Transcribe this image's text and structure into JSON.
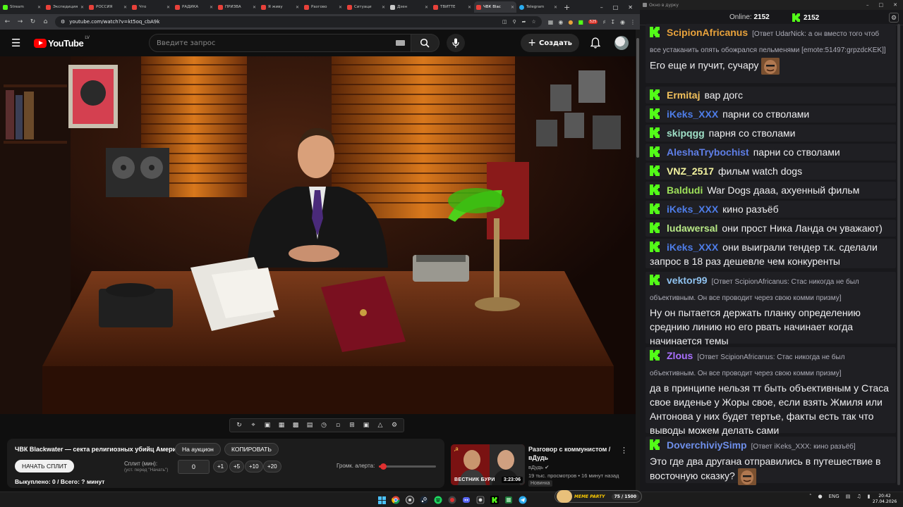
{
  "browser": {
    "tabs": [
      {
        "label": "Stream",
        "fav": "k",
        "active": false
      },
      {
        "label": "Экспедиция",
        "fav": "yt",
        "active": false
      },
      {
        "label": "РОССИЯ",
        "fav": "yt",
        "active": false
      },
      {
        "label": "Что",
        "fav": "yt",
        "active": false
      },
      {
        "label": "РАДИКА",
        "fav": "yt",
        "active": false
      },
      {
        "label": "ПРИЗВА",
        "fav": "yt",
        "active": false
      },
      {
        "label": "Я живу",
        "fav": "yt",
        "active": false
      },
      {
        "label": "Разгово",
        "fav": "yt",
        "active": false
      },
      {
        "label": "Ситуаци",
        "fav": "yt",
        "active": false
      },
      {
        "label": "Дзен",
        "fav": "dz",
        "active": false
      },
      {
        "label": "ТВИТТЕ",
        "fav": "yt",
        "active": false
      },
      {
        "label": "ЧВК Blac",
        "fav": "yt",
        "active": true
      },
      {
        "label": "Telegram",
        "fav": "tg",
        "active": false
      }
    ],
    "new_tab": "+",
    "url": "youtube.com/watch?v=kt5oq_cbA9k",
    "ext_badge": "525",
    "icons": [
      "back-icon",
      "forward-icon",
      "reload-icon",
      "home-icon",
      "site-info-icon",
      "star-icon",
      "extensions-icon",
      "download-icon",
      "menu-icon"
    ]
  },
  "youtube": {
    "logo_text": "YouTube",
    "country": "LV",
    "search_placeholder": "Введите запрос",
    "create_label": "Создать"
  },
  "auction": {
    "title": "ЧВК Blackwater — секта религиозных убийц Америки!",
    "auction_button": "На аукцион",
    "copy_button": "КОПИРОВАТЬ",
    "start_split_button": "НАЧАТЬ СПЛИТ",
    "split_label": "Сплит (мин):",
    "split_sub": "(уст. перед \"Начать\")",
    "split_value": "0",
    "steps": [
      "+1",
      "+5",
      "+10",
      "+20"
    ],
    "alert_label": "Громк. алерта:",
    "alert_volume": 0.07,
    "status": "Выкуплено: 0 / Всего: ? минут"
  },
  "recommendation": {
    "title": "Разговор с коммунистом / вДудь",
    "channel": "вДудь",
    "meta": "19 тыс. просмотров • 16 минут назад",
    "badge": "Новинка",
    "duration": "3:23:06",
    "thumb_text": "ВЕСТНИК БУРИ"
  },
  "chat": {
    "window_title": "Окно в дурку",
    "online_label": "Online:",
    "online_count": "2152",
    "viewers_count": "2152",
    "messages": [
      {
        "user": "ScipionAfricanus",
        "color": "#e8a23b",
        "reply": "[Ответ UdarNick: а он вместо того чтоб все устаканить опять обожрался пельменями [emote:51497:grpzdcKEK]]",
        "text": "Его еще и пучит, сучару",
        "emote": true
      },
      {
        "user": "Ermitaj",
        "color": "#f2c15c",
        "text": "вар догс"
      },
      {
        "user": "iKeks_XXX",
        "color": "#4e7de9",
        "text": "парни со стволами"
      },
      {
        "user": "skipqgg",
        "color": "#9fe0c7",
        "text": "парня со стволами"
      },
      {
        "user": "AleshaTrybochist",
        "color": "#5f7fe8",
        "text": "парни со стволами"
      },
      {
        "user": "VNZ_2517",
        "color": "#f5f5a0",
        "text": "фильм watch dogs"
      },
      {
        "user": "Baldudi",
        "color": "#9ee05a",
        "text": "War Dogs дааа, ахуенный фильм"
      },
      {
        "user": "iKeks_XXX",
        "color": "#4e7de9",
        "text": "кино разъёб"
      },
      {
        "user": "ludawersal",
        "color": "#b8e986",
        "text": "они прост Ника Ланда оч уважают)"
      },
      {
        "user": "iKeks_XXX",
        "color": "#4e7de9",
        "text": "они выиграли тендер т.к. сделали запрос в 18 раз дешевле чем конкуренты"
      },
      {
        "user": "vektor99",
        "color": "#8fc2ef",
        "reply": "[Ответ ScipionAfricanus: Стас никогда не был объективным. Он все проводит через свою комми призму]",
        "text": "Ну он пытается держать планку определению среднию линию но его рвать начинает когда начинается темы"
      },
      {
        "user": "Zlous",
        "color": "#a970ff",
        "reply": "[Ответ ScipionAfricanus: Стас никогда не был объективным. Он все проводит через свою комми призму]",
        "text": "да в принципе нельзя тт быть объективным у Стаса свое виденье у Жоры свое, если взять Жмиля или Антонова у них будет тертье, факты есть так что выводы можем делать сами"
      },
      {
        "user": "DoverchiviySimp",
        "color": "#6e8fea",
        "reply": "[Ответ iKeks_XXX: кино разъёб]",
        "text": "Это где два другана отправились в путешествие в восточную сказку?",
        "emote": true
      }
    ]
  },
  "taskbar": {
    "meme_title": "MEME PARTY",
    "meme_count": "75 / 1500",
    "lang": "ENG",
    "time": "20:42",
    "date": "27.04.2026"
  },
  "colors": {
    "kick_green": "#53fc18",
    "youtube_red": "#ff0000",
    "chat_bg": "#18181b",
    "msg_bg": "#1f1f23"
  }
}
